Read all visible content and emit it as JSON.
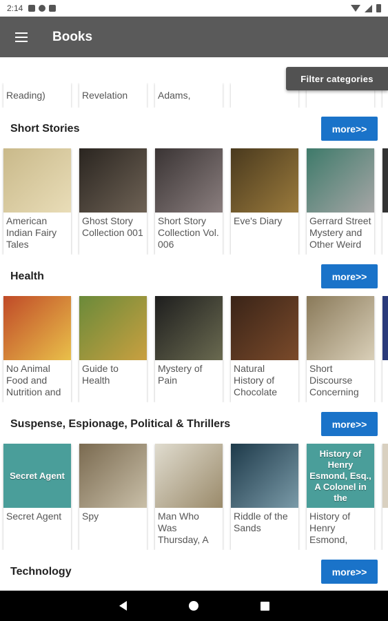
{
  "status_bar": {
    "time": "2:14"
  },
  "app_bar": {
    "title": "Books"
  },
  "filter": {
    "label": "Filter categories"
  },
  "partial_row": [
    "Reading)",
    "Revelation",
    "Adams,",
    "",
    "",
    ""
  ],
  "more_label": "more>>",
  "sections": [
    {
      "title": "Short Stories",
      "books": [
        {
          "title": "American Indian Fairy Tales",
          "cover_text": "",
          "cover_color": "#c9b98a",
          "cover_color2": "#e9ddb8"
        },
        {
          "title": "Ghost Story Collection 001",
          "cover_text": "",
          "cover_color": "#2a2520",
          "cover_color2": "#6e6255"
        },
        {
          "title": "Short Story Collection Vol. 006",
          "cover_text": "",
          "cover_color": "#3a3434",
          "cover_color2": "#8a7e7e"
        },
        {
          "title": "Eve's Diary",
          "cover_text": "",
          "cover_color": "#4a3a1e",
          "cover_color2": "#9a7a3c"
        },
        {
          "title": "Gerrard Street Mystery and Other Weird Tales",
          "cover_text": "",
          "cover_color": "#3e7a6a",
          "cover_color2": "#a6a6a6"
        },
        {
          "title": "",
          "cover_text": "",
          "cover_color": "#333333",
          "cover_color2": "#333333"
        }
      ]
    },
    {
      "title": "Health",
      "books": [
        {
          "title": "No Animal Food and Nutrition and",
          "cover_text": "",
          "cover_color": "#c04a28",
          "cover_color2": "#e9c04a"
        },
        {
          "title": "Guide to Health",
          "cover_text": "",
          "cover_color": "#6a8a3a",
          "cover_color2": "#c9a040"
        },
        {
          "title": "Mystery of Pain",
          "cover_text": "",
          "cover_color": "#1e1e1e",
          "cover_color2": "#6a6a50"
        },
        {
          "title": "Natural History of Chocolate",
          "cover_text": "",
          "cover_color": "#3a2418",
          "cover_color2": "#7a4a2a"
        },
        {
          "title": "Short Discourse Concerning",
          "cover_text": "",
          "cover_color": "#8a7a5a",
          "cover_color2": "#d9cfb8"
        },
        {
          "title": "",
          "cover_text": "",
          "cover_color": "#2a3a7a",
          "cover_color2": "#2a3a7a"
        }
      ]
    },
    {
      "title": "Suspense, Espionage, Political & Thrillers",
      "books": [
        {
          "title": "Secret Agent",
          "cover_text": "Secret Agent",
          "cover_color": "#4a9e9a",
          "cover_color2": "#4a9e9a"
        },
        {
          "title": "Spy",
          "cover_text": "",
          "cover_color": "#7a6a50",
          "cover_color2": "#c9bfa8"
        },
        {
          "title": "Man Who Was Thursday, A",
          "cover_text": "",
          "cover_color": "#e0dccf",
          "cover_color2": "#9a8a6a"
        },
        {
          "title": "Riddle of the Sands",
          "cover_text": "",
          "cover_color": "#1e3a4a",
          "cover_color2": "#7a9aa8"
        },
        {
          "title": "History of Henry Esmond, Esq.,",
          "cover_text": "History of Henry Esmond, Esq., A Colonel in the",
          "cover_color": "#4a9e9a",
          "cover_color2": "#4a9e9a"
        },
        {
          "title": "",
          "cover_text": "",
          "cover_color": "#d9d0c0",
          "cover_color2": "#d9d0c0"
        }
      ]
    },
    {
      "title": "Technology",
      "books": []
    }
  ]
}
